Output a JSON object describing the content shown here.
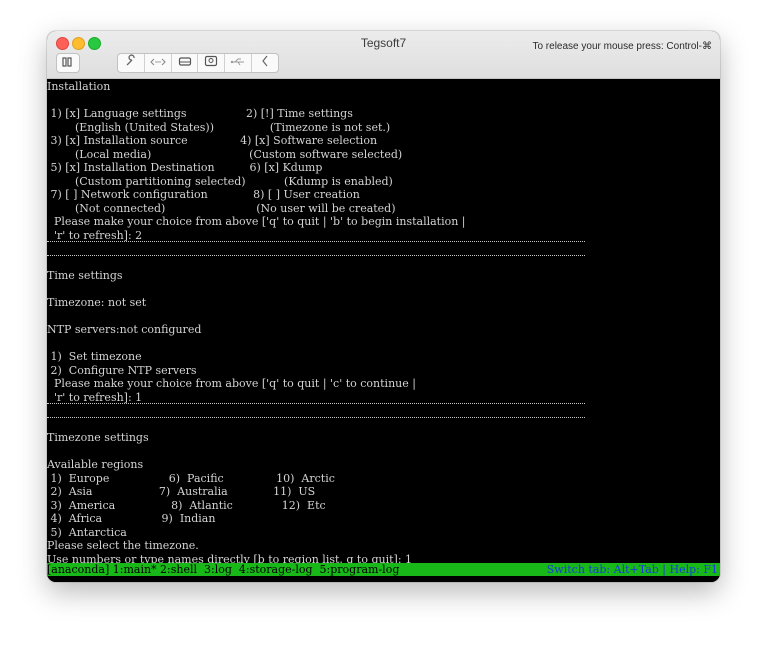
{
  "window": {
    "title": "Tegsoft7",
    "release_hint": "To release your mouse press: Control-⌘"
  },
  "toolbar": {
    "icons": [
      "sidebar-icon",
      "wrench-icon",
      "code-arrows-icon",
      "hard-disk-icon",
      "camera-icon",
      "usb-icon",
      "back-chevron-icon"
    ]
  },
  "terminal": {
    "lines": [
      "Installation",
      "",
      " 1) [x] Language settings                 2) [!] Time settings",
      "        (English (United States))                (Timezone is not set.)",
      " 3) [x] Installation source               4) [x] Software selection",
      "        (Local media)                            (Custom software selected)",
      " 5) [x] Installation Destination          6) [x] Kdump",
      "        (Custom partitioning selected)           (Kdump is enabled)",
      " 7) [ ] Network configuration             8) [ ] User creation",
      "        (Not connected)                          (No user will be created)",
      "  Please make your choice from above ['q' to quit | 'b' to begin installation |",
      "  'r' to refresh]: 2",
      "",
      "",
      "Time settings",
      "",
      "Timezone: not set",
      "",
      "NTP servers:not configured",
      "",
      " 1)  Set timezone",
      " 2)  Configure NTP servers",
      "  Please make your choice from above ['q' to quit | 'c' to continue |",
      "  'r' to refresh]: 1",
      "",
      "",
      "Timezone settings",
      "",
      "Available regions",
      " 1)  Europe                 6)  Pacific               10)  Arctic",
      " 2)  Asia                   7)  Australia             11)  US",
      " 3)  America                8)  Atlantic              12)  Etc",
      " 4)  Africa                 9)  Indian",
      " 5)  Antarctica",
      "Please select the timezone.",
      "Use numbers or type names directly [b to region list, q to quit]: 1"
    ],
    "status_left": "[anaconda] 1:main* 2:shell  3:log  4:storage-log  5:program-log",
    "status_right": "Switch tab: Alt+Tab | Help: F1",
    "status_color": "#18b818",
    "text_color": "#d4d4d4",
    "background": "#000000"
  }
}
